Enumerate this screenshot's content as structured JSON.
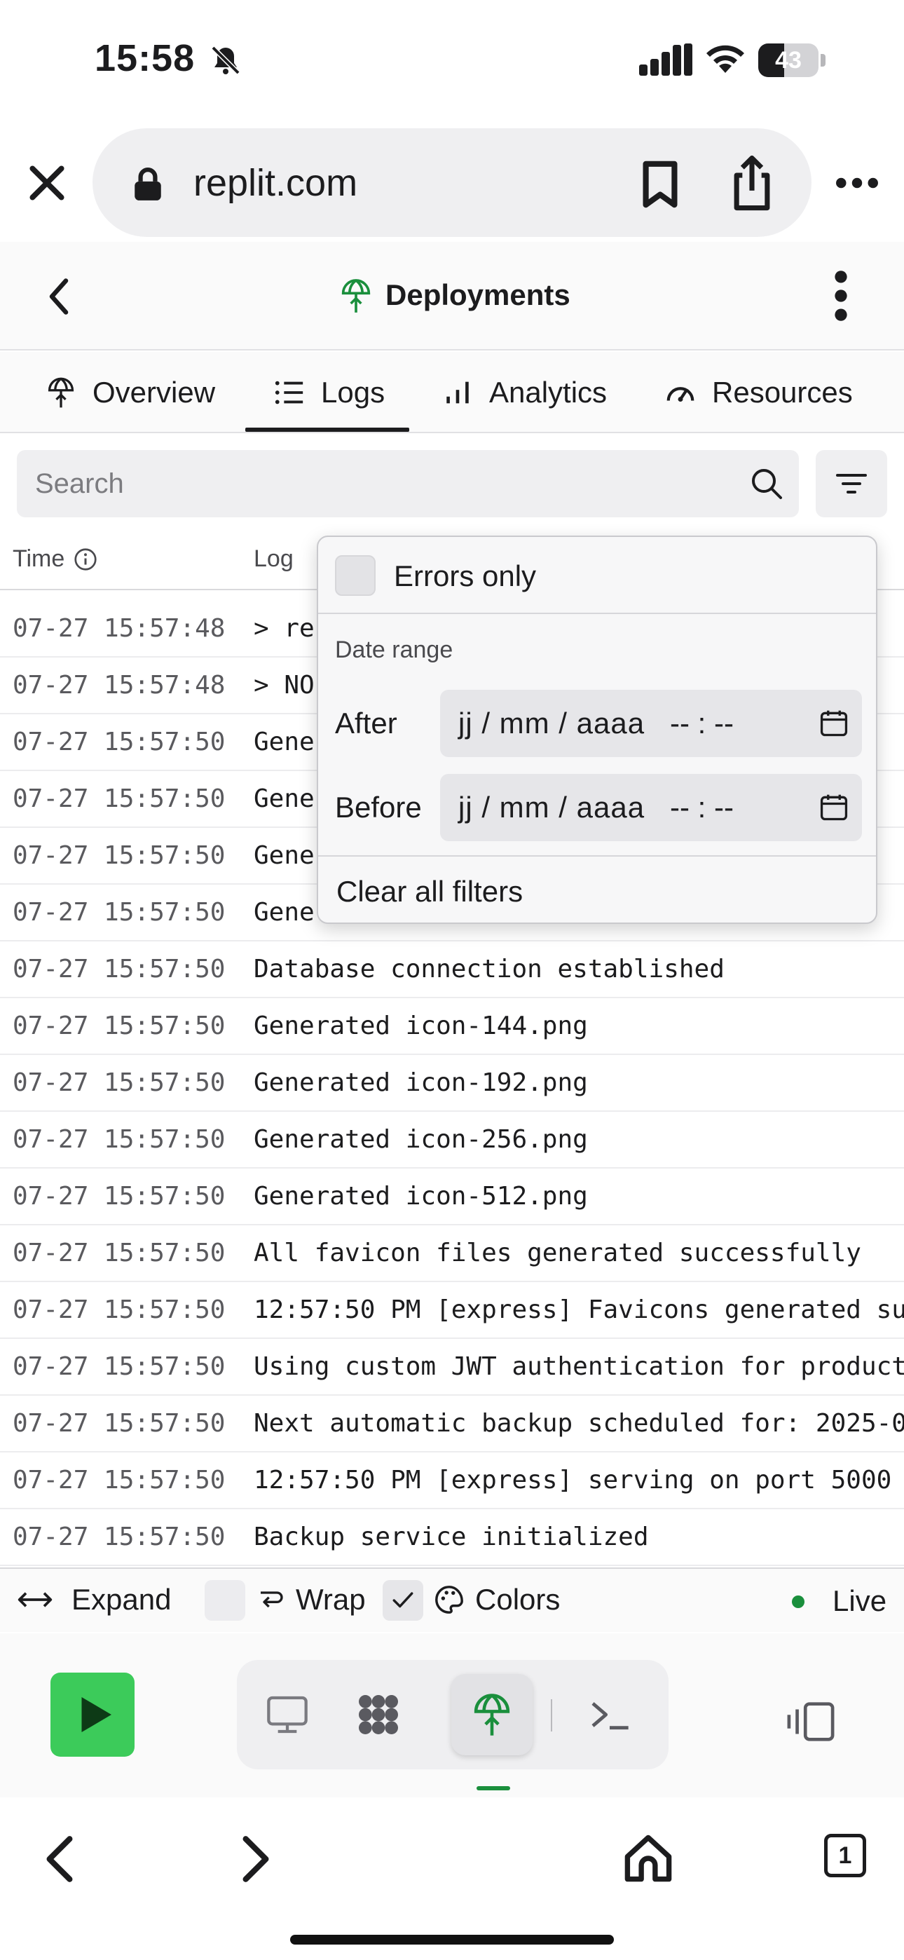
{
  "status_bar": {
    "time": "15:58",
    "battery_text": "43",
    "battery_level": 0.43
  },
  "browser": {
    "url": "replit.com",
    "tab_count": "1"
  },
  "header": {
    "title": "Deployments"
  },
  "tabs": [
    {
      "label": "Overview",
      "icon": "deployment-icon"
    },
    {
      "label": "Logs",
      "icon": "list-icon",
      "active": true
    },
    {
      "label": "Analytics",
      "icon": "bar-chart-icon"
    },
    {
      "label": "Resources",
      "icon": "gauge-icon"
    }
  ],
  "search": {
    "placeholder": "Search",
    "value": ""
  },
  "table": {
    "col_time": "Time",
    "col_log": "Log",
    "rows": [
      {
        "time": "07-27 15:57:48",
        "msg": "> re"
      },
      {
        "time": "07-27 15:57:48",
        "msg": "> NO"
      },
      {
        "time": "07-27 15:57:50",
        "msg": "Gene"
      },
      {
        "time": "07-27 15:57:50",
        "msg": "Gene"
      },
      {
        "time": "07-27 15:57:50",
        "msg": "Gene"
      },
      {
        "time": "07-27 15:57:50",
        "msg": "Gene"
      },
      {
        "time": "07-27 15:57:50",
        "msg": "Database connection established"
      },
      {
        "time": "07-27 15:57:50",
        "msg": "Generated icon-144.png"
      },
      {
        "time": "07-27 15:57:50",
        "msg": "Generated icon-192.png"
      },
      {
        "time": "07-27 15:57:50",
        "msg": "Generated icon-256.png"
      },
      {
        "time": "07-27 15:57:50",
        "msg": "Generated icon-512.png"
      },
      {
        "time": "07-27 15:57:50",
        "msg": "All favicon files generated successfully"
      },
      {
        "time": "07-27 15:57:50",
        "msg": "12:57:50 PM [express] Favicons generated su"
      },
      {
        "time": "07-27 15:57:50",
        "msg": "Using custom JWT authentication for product"
      },
      {
        "time": "07-27 15:57:50",
        "msg": "Next automatic backup scheduled for: 2025-0"
      },
      {
        "time": "07-27 15:57:50",
        "msg": "12:57:50 PM [express] serving on port 5000"
      },
      {
        "time": "07-27 15:57:50",
        "msg": "Backup service initialized"
      }
    ]
  },
  "filter_popover": {
    "errors_only_label": "Errors only",
    "errors_only_checked": false,
    "date_range_label": "Date range",
    "after_label": "After",
    "before_label": "Before",
    "date_placeholder": "jj / mm / aaaa",
    "time_placeholder": "-- : --",
    "clear_label": "Clear all filters"
  },
  "toolbar": {
    "expand_label": "Expand",
    "wrap_label": "Wrap",
    "wrap_checked": false,
    "colors_label": "Colors",
    "colors_checked": true,
    "live_label": "Live"
  },
  "colors": {
    "accent_green": "#1a8f3c",
    "run_button": "#3ccb5a"
  }
}
